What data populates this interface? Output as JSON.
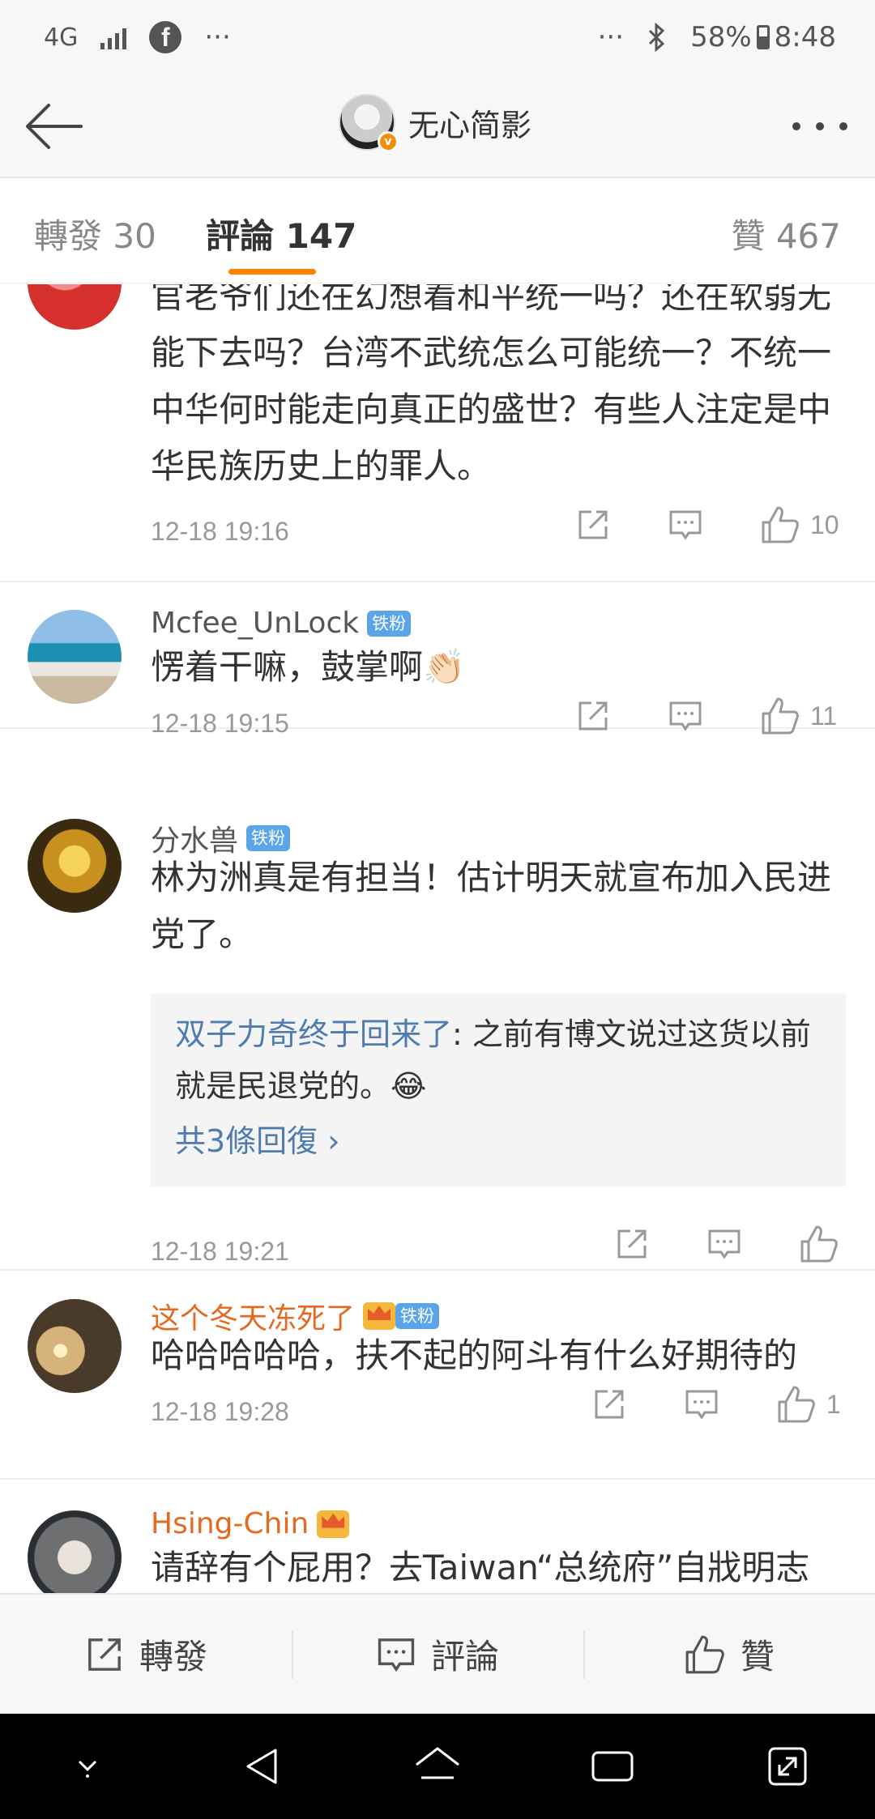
{
  "status_bar": {
    "network": "4G",
    "more": "···",
    "more_right": "···",
    "battery": "58%",
    "time": "8:48"
  },
  "header": {
    "title": "无心简影",
    "verified_badge": "v"
  },
  "tabs": {
    "repost": "轉發 30",
    "comments": "評論 147",
    "likes": "贊 467"
  },
  "comments": [
    {
      "text": "官老爷们还在幻想着和平统一吗？还在软弱无能下去吗？台湾不武统怎么可能统一？不统一中华何时能走向真正的盛世？有些人注定是中华民族历史上的罪人。",
      "time": "12-18 19:16",
      "likes": "10"
    },
    {
      "user": "Mcfee_UnLock",
      "badge": "铁粉",
      "text": "愣着干嘛，鼓掌啊👏🏻",
      "time": "12-18 19:15",
      "likes": "11"
    },
    {
      "user": "分水兽",
      "badge": "铁粉",
      "text": "林为洲真是有担当！估计明天就宣布加入民进党了。",
      "reply_user": "双子力奇终于回来了",
      "reply_text": ": 之前有博文说过这货以前就是民退党的。😂",
      "reply_more": "共3條回復 ›",
      "time": "12-18 19:21",
      "likes": ""
    },
    {
      "user": "这个冬天冻死了",
      "badge": "铁粉",
      "text": "哈哈哈哈哈，扶不起的阿斗有什么好期待的",
      "time": "12-18 19:28",
      "likes": "1"
    },
    {
      "user": "Hsing-Chin",
      "text": "请辞有个屁用？去Taiwan“总统府”自戕明志"
    }
  ],
  "bottom_bar": {
    "repost": "轉發",
    "comment": "評論",
    "like": "贊"
  },
  "colors": {
    "accent": "#ff8200",
    "link": "#4f7caf",
    "username_vip": "#e5691e",
    "fan_badge": "#5aa5ea"
  }
}
